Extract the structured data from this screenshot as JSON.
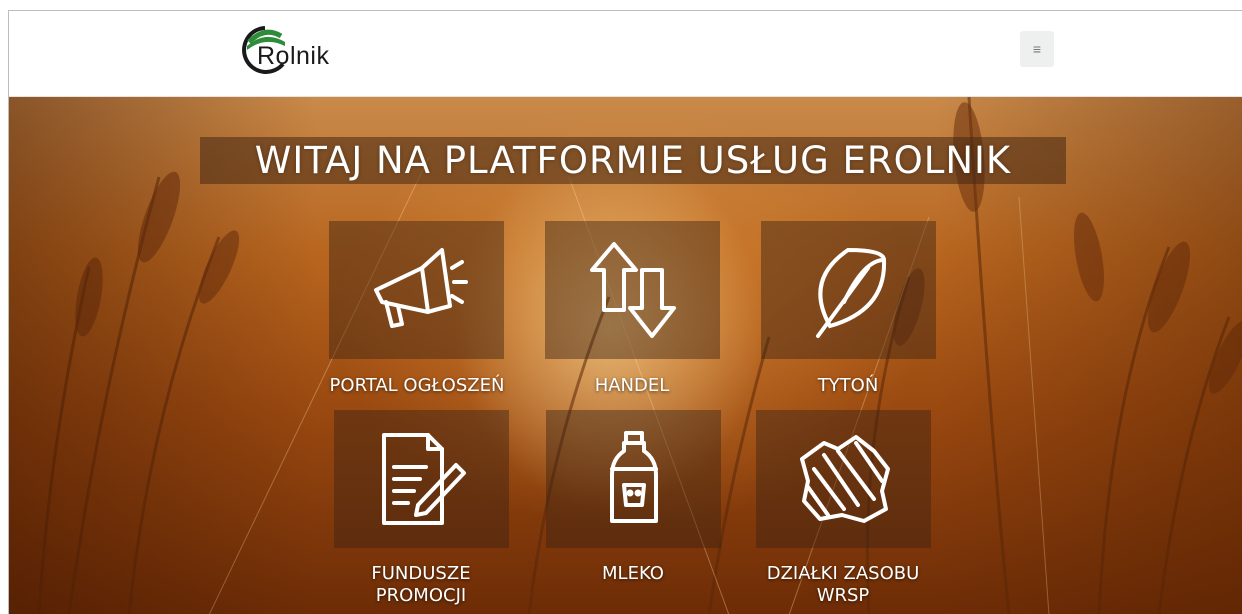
{
  "header": {
    "logo_text": "Rolnik",
    "menu_icon": "hamburger-icon",
    "menu_glyph": "≡"
  },
  "hero": {
    "title": "WITAJ NA PLATFORMIE USŁUG EROLNIK"
  },
  "tiles": [
    {
      "label": "PORTAL OGŁOSZEŃ",
      "icon": "megaphone-icon"
    },
    {
      "label": "HANDEL",
      "icon": "trade-arrows-icon"
    },
    {
      "label": "TYTOŃ",
      "icon": "leaf-icon"
    },
    {
      "label_line1": "FUNDUSZE",
      "label_line2": "PROMOCJI",
      "icon": "document-pen-icon"
    },
    {
      "label": "MLEKO",
      "icon": "milk-can-icon"
    },
    {
      "label_line1": "DZIAŁKI ZASOBU",
      "label_line2": "WRSP",
      "icon": "land-map-icon"
    }
  ],
  "colors": {
    "logo_green": "#2e8b3a",
    "logo_dark": "#1a1a1a",
    "tile_overlay": "#3c2314",
    "text": "#ffffff"
  }
}
